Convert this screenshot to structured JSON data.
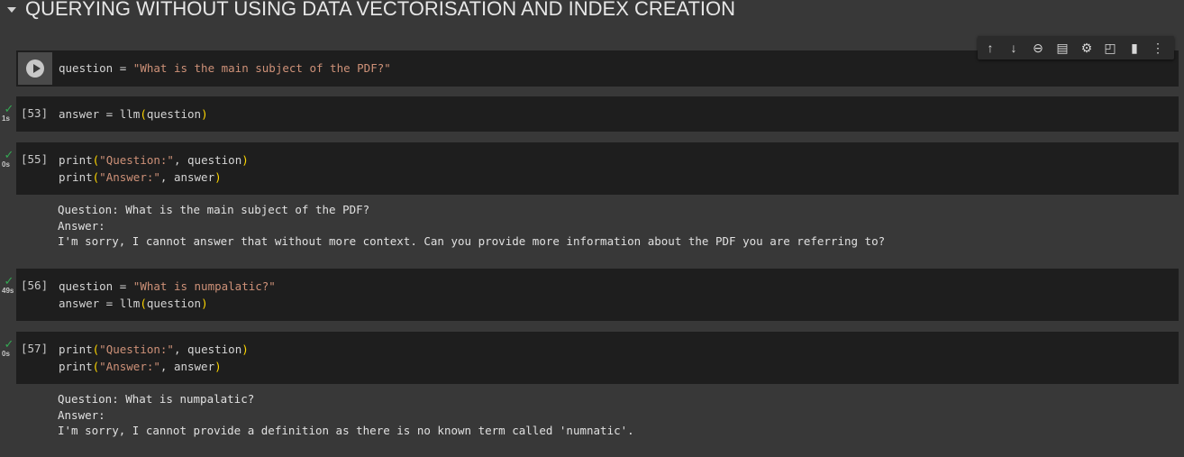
{
  "section": {
    "title": "QUERYING WITHOUT USING DATA VECTORISATION AND INDEX CREATION"
  },
  "toolbar": {
    "icons": [
      "arrow-up-icon",
      "arrow-down-icon",
      "link-icon",
      "comment-icon",
      "gear-icon",
      "mirror-cell-icon",
      "delete-icon",
      "more-vert-icon"
    ]
  },
  "cells": [
    {
      "exec": "",
      "time": "",
      "lines": [
        [
          [
            "fn",
            "question = "
          ],
          [
            "str",
            "\"What is the main subject of the PDF?\""
          ]
        ]
      ]
    },
    {
      "exec": "[53]",
      "time": "1s",
      "lines": [
        [
          [
            "fn",
            "answer = llm"
          ],
          [
            "par",
            "("
          ],
          [
            "fn",
            "question"
          ],
          [
            "par",
            ")"
          ]
        ]
      ]
    },
    {
      "exec": "[55]",
      "time": "0s",
      "lines": [
        [
          [
            "fn",
            "print"
          ],
          [
            "par",
            "("
          ],
          [
            "str",
            "\"Question:\""
          ],
          [
            "fn",
            ", question"
          ],
          [
            "par",
            ")"
          ]
        ],
        [
          [
            "fn",
            "print"
          ],
          [
            "par",
            "("
          ],
          [
            "str",
            "\"Answer:\""
          ],
          [
            "fn",
            ", answer"
          ],
          [
            "par",
            ")"
          ]
        ]
      ],
      "output": [
        "Question: What is the main subject of the PDF?",
        "Answer:",
        "I'm sorry, I cannot answer that without more context. Can you provide more information about the PDF you are referring to?"
      ]
    },
    {
      "exec": "[56]",
      "time": "49s",
      "lines": [
        [
          [
            "fn",
            "question = "
          ],
          [
            "str",
            "\"What is numpalatic?\""
          ]
        ],
        [
          [
            "fn",
            "answer = llm"
          ],
          [
            "par",
            "("
          ],
          [
            "fn",
            "question"
          ],
          [
            "par",
            ")"
          ]
        ]
      ]
    },
    {
      "exec": "[57]",
      "time": "0s",
      "lines": [
        [
          [
            "fn",
            "print"
          ],
          [
            "par",
            "("
          ],
          [
            "str",
            "\"Question:\""
          ],
          [
            "fn",
            ", question"
          ],
          [
            "par",
            ")"
          ]
        ],
        [
          [
            "fn",
            "print"
          ],
          [
            "par",
            "("
          ],
          [
            "str",
            "\"Answer:\""
          ],
          [
            "fn",
            ", answer"
          ],
          [
            "par",
            ")"
          ]
        ]
      ],
      "output": [
        "Question: What is numpalatic?",
        "Answer:",
        "I'm sorry, I cannot provide a definition as there is no known term called 'numnatic'."
      ]
    }
  ],
  "colors": {
    "string": "#ce9178",
    "paren": "#ffd700",
    "check": "#34a853",
    "cell_bg": "#1e1e1e",
    "page_bg": "#383838"
  }
}
